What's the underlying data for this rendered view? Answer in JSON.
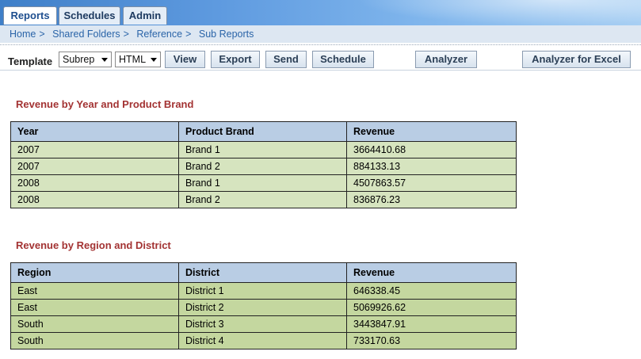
{
  "tabs": [
    {
      "label": "Reports"
    },
    {
      "label": "Schedules"
    },
    {
      "label": "Admin"
    }
  ],
  "breadcrumb": {
    "items": [
      "Home",
      "Shared Folders",
      "Reference",
      "Sub Reports"
    ],
    "separator": ">"
  },
  "toolbar": {
    "template_label": "Template",
    "template_select": "Subrep",
    "format_select": "HTML",
    "buttons": {
      "view": "View",
      "export": "Export",
      "send": "Send",
      "schedule": "Schedule",
      "analyzer": "Analyzer",
      "analyzer_excel": "Analyzer for Excel"
    }
  },
  "report1": {
    "title": "Revenue by Year and Product Brand",
    "headers": [
      "Year",
      "Product Brand",
      "Revenue"
    ],
    "rows": [
      [
        "2007",
        "Brand 1",
        "3664410.68"
      ],
      [
        "2007",
        "Brand 2",
        "884133.13"
      ],
      [
        "2008",
        "Brand 1",
        "4507863.57"
      ],
      [
        "2008",
        "Brand 2",
        "836876.23"
      ]
    ]
  },
  "report2": {
    "title": "Revenue by Region and District",
    "headers": [
      "Region",
      "District",
      "Revenue"
    ],
    "rows": [
      [
        "East",
        "District 1",
        "646338.45"
      ],
      [
        "East",
        "District 2",
        "5069926.62"
      ],
      [
        "South",
        "District 3",
        "3443847.91"
      ],
      [
        "South",
        "District 4",
        "733170.63"
      ]
    ]
  },
  "colors": {
    "tab_gradient_start": "#3f7fc8",
    "breadcrumb_bg": "#dde7f2",
    "link": "#2a64a8",
    "section_title": "#a33333",
    "table_header": "#b9cde4",
    "table1_row": "#d6e4bf",
    "table2_row": "#c4d79f"
  }
}
